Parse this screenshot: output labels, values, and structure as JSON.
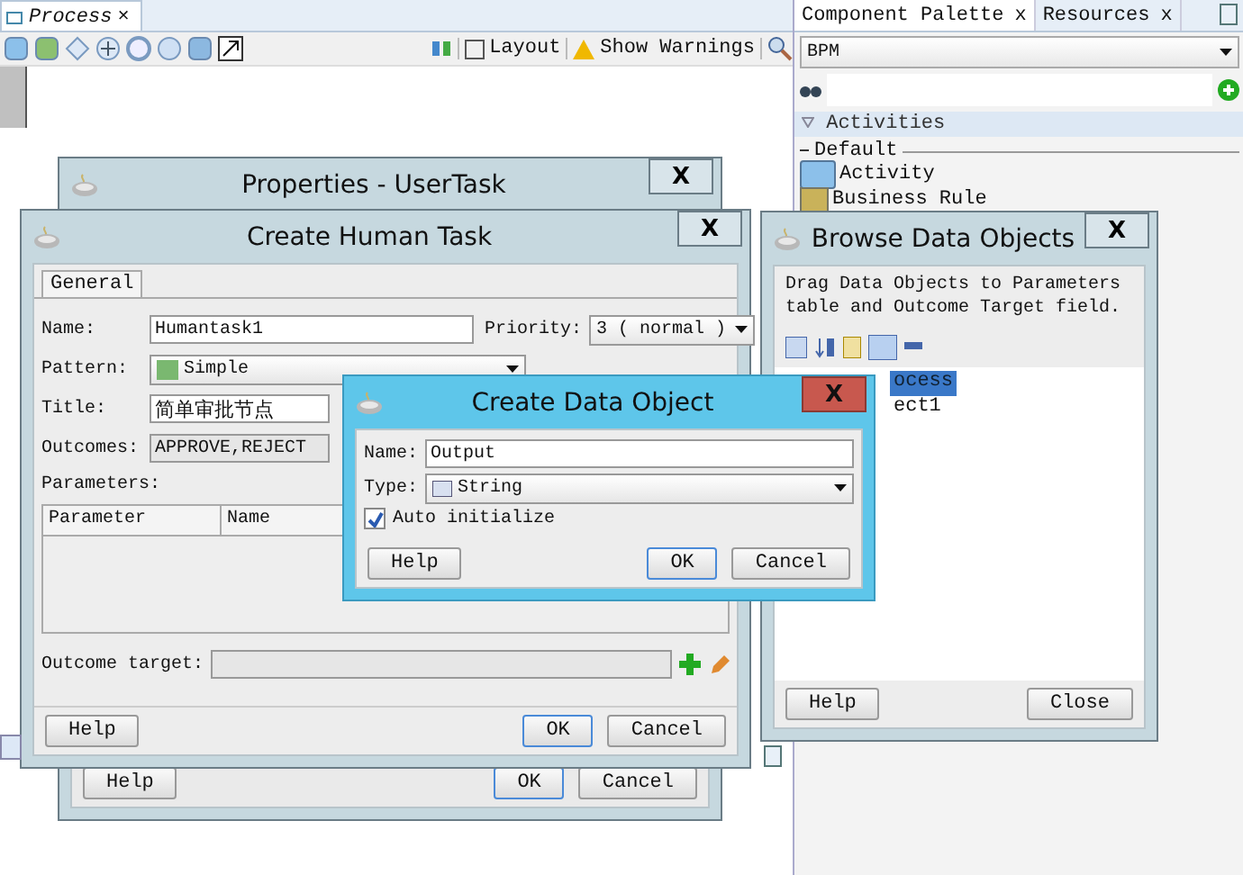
{
  "editor": {
    "tab": "Process",
    "tab_close": "×",
    "toolbar": [
      "Layout",
      "Show Warnings"
    ]
  },
  "palette": {
    "tabs": [
      {
        "label": "Component Palette",
        "close": "x",
        "selected": true
      },
      {
        "label": "Resources",
        "close": "x",
        "selected": false
      }
    ],
    "category": "BPM",
    "section": "Activities",
    "group": "Default",
    "items": [
      "Activity",
      "Business Rule"
    ]
  },
  "properties_dialog": {
    "title": "Properties - UserTask",
    "close": "X",
    "buttons": [
      {
        "label": "Help",
        "default": false
      },
      {
        "label": "OK",
        "default": true
      },
      {
        "label": "Cancel",
        "default": false
      }
    ]
  },
  "human_task_dialog": {
    "title": "Create Human Task",
    "close": "X",
    "tab": "General",
    "fields": [
      {
        "label": "Name:",
        "value": "Humantask1"
      },
      {
        "label": "Pattern:",
        "value": "Simple"
      },
      {
        "label": "Title:",
        "value": "简单审批节点"
      },
      {
        "label": "Outcomes:",
        "value": "APPROVE,REJECT"
      }
    ],
    "priority": {
      "label": "Priority:",
      "value": "3 ( normal )"
    },
    "parameters": {
      "label": "Parameters:",
      "columns": [
        "Parameter",
        "Name"
      ]
    },
    "outcome_target": {
      "label": "Outcome target:"
    },
    "buttons": [
      {
        "label": "Help",
        "default": false
      },
      {
        "label": "OK",
        "default": true
      },
      {
        "label": "Cancel",
        "default": false
      }
    ]
  },
  "browse_dialog": {
    "title": "Browse Data Objects",
    "close": "X",
    "hint": "Drag Data Objects to Parameters table and Outcome Target field.",
    "tree": [
      {
        "label": "ocess",
        "selected": true
      },
      {
        "label": "ect1",
        "selected": false
      }
    ],
    "buttons": [
      {
        "label": "Help",
        "default": false
      },
      {
        "label": "Close",
        "default": false
      }
    ]
  },
  "data_object_dialog": {
    "title": "Create Data Object",
    "close": "X",
    "name_label": "Name:",
    "name_value": "Output",
    "type_label": "Type:",
    "type_value": "String",
    "auto_init": {
      "label": "Auto initialize",
      "checked": true
    },
    "buttons": [
      {
        "label": "Help",
        "default": false
      },
      {
        "label": "OK",
        "default": true
      },
      {
        "label": "Cancel",
        "default": false
      }
    ]
  }
}
